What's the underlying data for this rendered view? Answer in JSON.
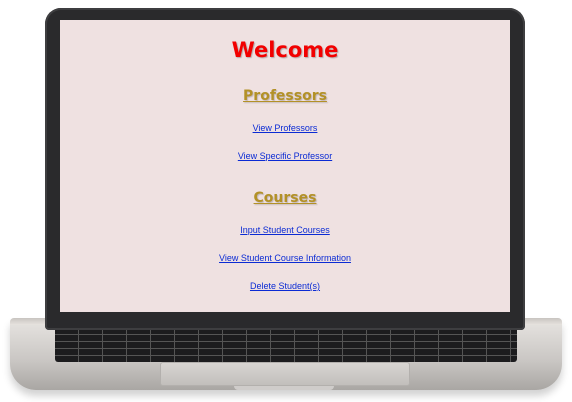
{
  "page": {
    "title": "Welcome",
    "sections": {
      "professors": {
        "heading": "Professors",
        "links": [
          "View Professors",
          "View Specific Professor"
        ]
      },
      "courses": {
        "heading": "Courses",
        "links": [
          "Input Student Courses",
          "View Student Course Information",
          "Delete Student(s)"
        ]
      }
    }
  },
  "colors": {
    "title": "#f20000",
    "heading": "#b39127",
    "link": "#0b2bd4",
    "background": "#efe1e1"
  }
}
